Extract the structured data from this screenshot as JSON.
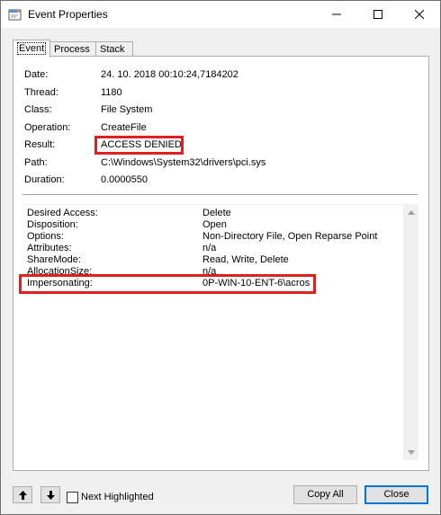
{
  "window": {
    "title": "Event Properties"
  },
  "tabs": [
    {
      "label": "Event",
      "active": true
    },
    {
      "label": "Process",
      "active": false
    },
    {
      "label": "Stack",
      "active": false
    }
  ],
  "event": {
    "rows": [
      {
        "label": "Date:",
        "value": "24. 10. 2018 00:10:24,7184202"
      },
      {
        "label": "Thread:",
        "value": "1180"
      },
      {
        "label": "Class:",
        "value": "File System"
      },
      {
        "label": "Operation:",
        "value": "CreateFile"
      },
      {
        "label": "Result:",
        "value": "ACCESS DENIED"
      },
      {
        "label": "Path:",
        "value": "C:\\Windows\\System32\\drivers\\pci.sys"
      },
      {
        "label": "Duration:",
        "value": "0.0000550"
      }
    ]
  },
  "details": {
    "rows": [
      {
        "label": "Desired Access:",
        "value": "Delete"
      },
      {
        "label": "Disposition:",
        "value": "Open"
      },
      {
        "label": "Options:",
        "value": "Non-Directory File, Open Reparse Point"
      },
      {
        "label": "Attributes:",
        "value": "n/a"
      },
      {
        "label": "ShareMode:",
        "value": "Read, Write, Delete"
      },
      {
        "label": "AllocationSize:",
        "value": "n/a"
      },
      {
        "label": "Impersonating:",
        "value": "0P-WIN-10-ENT-6\\acros"
      }
    ]
  },
  "footer": {
    "next_highlighted_label": "Next Highlighted",
    "next_highlighted_checked": false,
    "copy_all_label": "Copy All",
    "close_label": "Close"
  },
  "colors": {
    "highlight": "#e02020",
    "focus": "#0078d7"
  },
  "icons": [
    "app-icon",
    "minimize-icon",
    "maximize-icon",
    "close-icon",
    "arrow-up-icon",
    "arrow-down-icon",
    "scroll-up-icon",
    "scroll-down-icon"
  ]
}
